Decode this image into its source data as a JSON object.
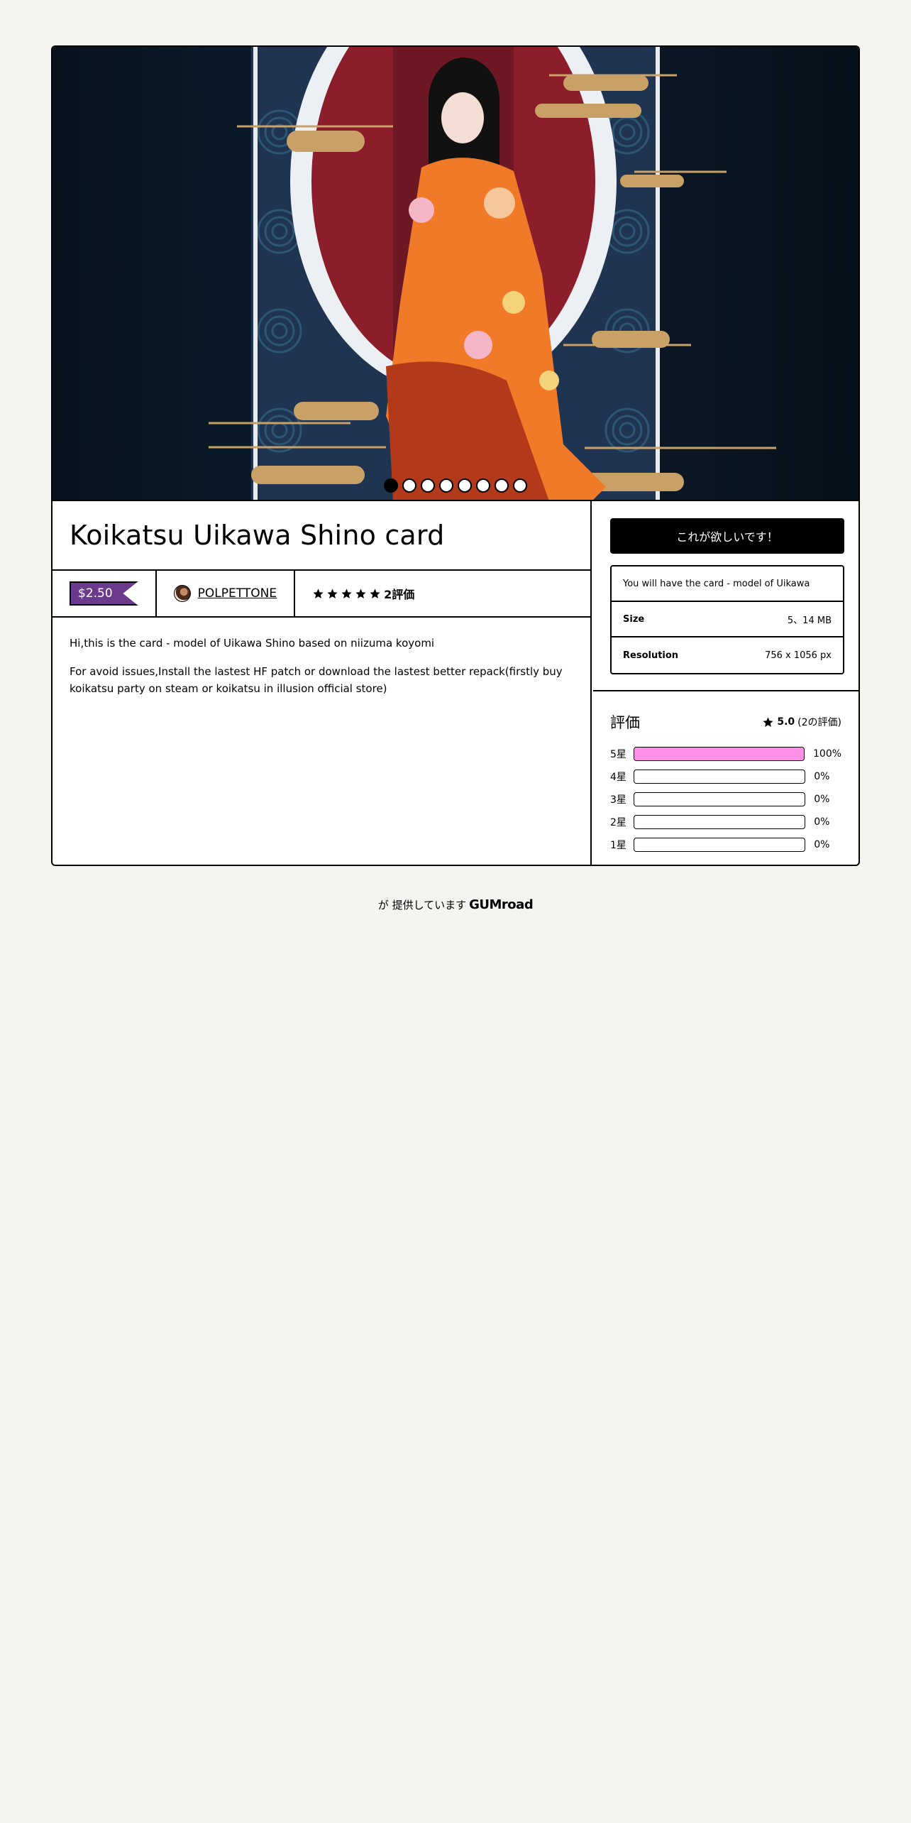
{
  "product": {
    "title": "Koikatsu Uikawa Shino card",
    "price": "$2.50",
    "creator": "POLPETTONE",
    "rating_count_label": "2評価",
    "stars": 5,
    "cover_images_count": 8,
    "active_image_index": 0
  },
  "description": {
    "p1": "Hi,this is the card - model of Uikawa Shino based on niizuma koyomi",
    "p2": "For avoid issues,Install the lastest HF patch or download the lastest better repack(firstly buy koikatsu party on steam or koikatsu in illusion official store)"
  },
  "purchase": {
    "button_label": "これが欲しいです！",
    "summary": "You will have the card - model of Uikawa",
    "attributes": [
      {
        "key": "Size",
        "value": "5、14 MB"
      },
      {
        "key": "Resolution",
        "value": "756 x 1056 px"
      }
    ]
  },
  "ratings": {
    "title": "評価",
    "average": "5.0",
    "count_label": "(2の評価)",
    "breakdown": [
      {
        "label": "5星",
        "percent": 100,
        "percent_label": "100%"
      },
      {
        "label": "4星",
        "percent": 0,
        "percent_label": "0%"
      },
      {
        "label": "3星",
        "percent": 0,
        "percent_label": "0%"
      },
      {
        "label": "2星",
        "percent": 0,
        "percent_label": "0%"
      },
      {
        "label": "1星",
        "percent": 0,
        "percent_label": "0%"
      }
    ]
  },
  "footer": {
    "text": "が 提供しています",
    "brand": "GUMroad"
  },
  "colors": {
    "background": "#f4f4f0",
    "price_tag": "#6b3a8c",
    "rating_bar": "#ff90e8",
    "button": "#000000"
  }
}
